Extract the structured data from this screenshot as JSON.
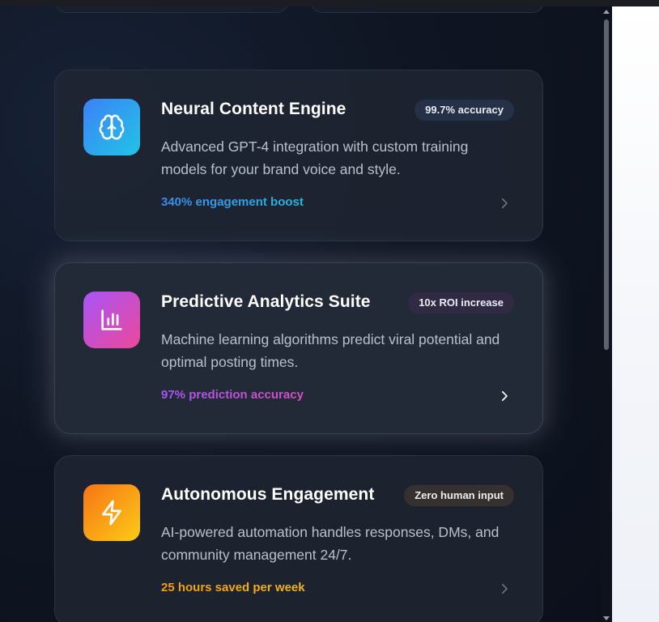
{
  "features": [
    {
      "title": "Neural Content Engine",
      "badge": "99.7% accuracy",
      "description": "Advanced GPT-4 integration with custom training models for your brand voice and style.",
      "metric": "340% engagement boost",
      "icon": "brain-icon",
      "colors": {
        "tile_from": "#3b82f6",
        "tile_to": "#22c4e6",
        "metric_from": "#3b8bf0",
        "metric_to": "#22b8e0",
        "badge_bg": "#253146"
      }
    },
    {
      "title": "Predictive Analytics Suite",
      "badge": "10x ROI increase",
      "description": "Machine learning algorithms predict viral potential and optimal posting times.",
      "metric": "97% prediction accuracy",
      "icon": "bar-chart-icon",
      "colors": {
        "tile_from": "#a855f7",
        "tile_to": "#ec4899",
        "metric_from": "#a855f7",
        "metric_to": "#d64fc0",
        "badge_bg": "#302a44"
      }
    },
    {
      "title": "Autonomous Engagement",
      "badge": "Zero human input",
      "description": "AI-powered automation handles responses, DMs, and community management 24/7.",
      "metric": "25 hours saved per week",
      "icon": "lightning-icon",
      "colors": {
        "tile_from": "#f97316",
        "tile_to": "#facc15",
        "metric_from": "#f59e0b",
        "metric_to": "#f2b81a",
        "badge_bg": "#36302e"
      }
    }
  ]
}
